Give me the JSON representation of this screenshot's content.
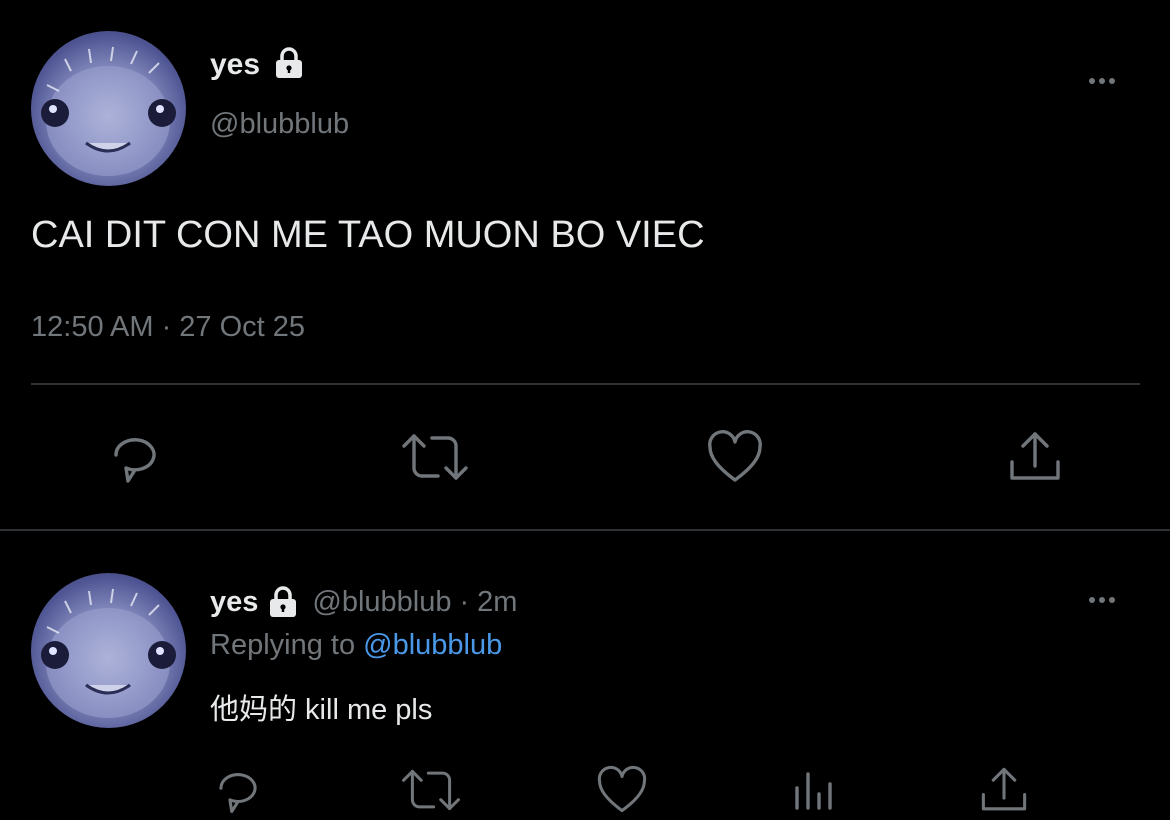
{
  "main_tweet": {
    "display_name": "yes",
    "handle": "@blubblub",
    "text": "CAI DIT CON ME TAO MUON BO VIEC",
    "timestamp": "12:50 AM · 27 Oct 25",
    "avatar_icon": "pufferfish-avatar",
    "more_icon": "more-horizontal-icon",
    "actions": [
      "reply-icon",
      "retweet-icon",
      "like-icon",
      "share-icon"
    ]
  },
  "reply_tweet": {
    "display_name": "yes",
    "handle": "@blubblub",
    "time_ago": "2m",
    "separator": "·",
    "replying_label": "Replying to",
    "replying_handle": "@blubblub",
    "text": "他妈的 kill me pls",
    "avatar_icon": "pufferfish-avatar",
    "more_icon": "more-horizontal-icon",
    "actions": [
      "reply-icon",
      "retweet-icon",
      "like-icon",
      "analytics-icon",
      "share-icon"
    ]
  },
  "colors": {
    "background": "#000000",
    "text": "#e7e9ea",
    "muted": "#71767b",
    "link": "#4a99e9",
    "divider": "#2f3336"
  }
}
